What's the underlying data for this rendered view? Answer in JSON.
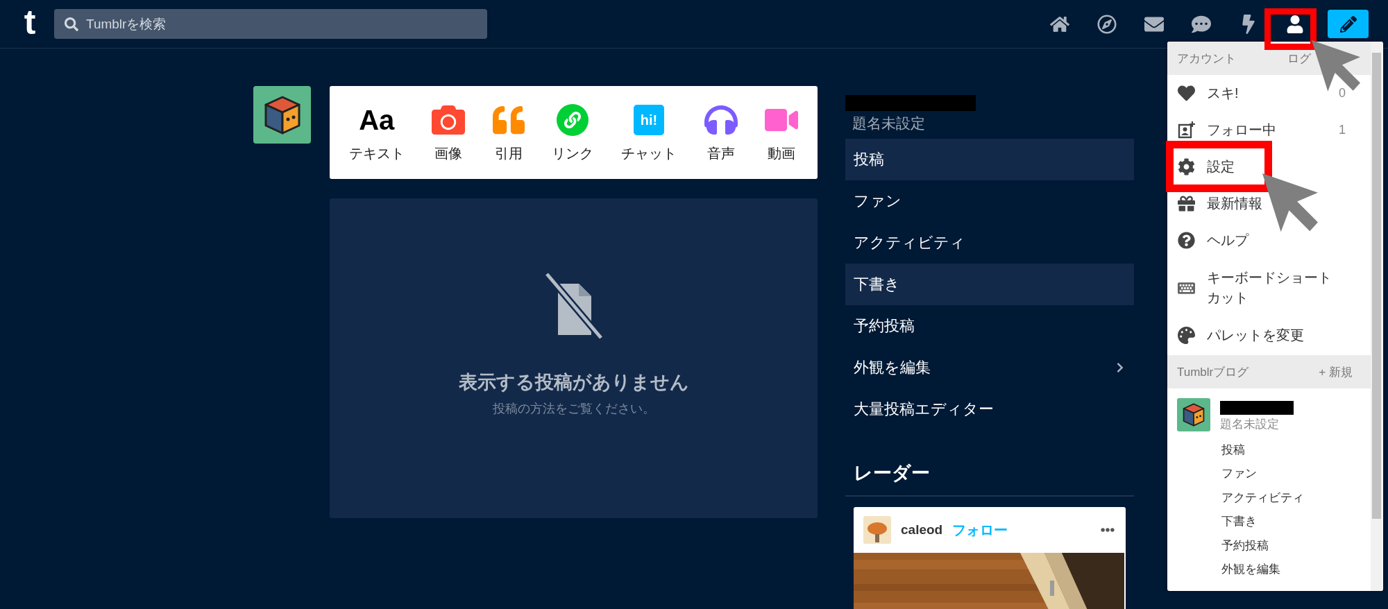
{
  "header": {
    "logo": "t",
    "search": {
      "placeholder": "Tumblrを検索"
    }
  },
  "post_types": [
    {
      "kind": "text",
      "glyph": "Aa",
      "label": "テキスト"
    },
    {
      "label": "画像"
    },
    {
      "kind": "quote",
      "label": "引用"
    },
    {
      "kind": "link",
      "label": "リンク"
    },
    {
      "kind": "chat",
      "glyph": "hi!",
      "label": "チャット"
    },
    {
      "kind": "audio",
      "label": "音声"
    },
    {
      "kind": "video",
      "label": "動画"
    }
  ],
  "empty_state": {
    "title": "表示する投稿がありません",
    "subtitle": "投稿の方法をご覧ください。"
  },
  "blog_menu": {
    "subtitle": "題名未設定",
    "items": [
      {
        "label": "投稿",
        "selected": true,
        "has_submenu": false
      },
      {
        "label": "ファン",
        "selected": false,
        "has_submenu": false
      },
      {
        "label": "アクティビティ",
        "selected": false,
        "has_submenu": false
      },
      {
        "label": "下書き",
        "selected": true,
        "has_submenu": false
      },
      {
        "label": "予約投稿",
        "selected": false,
        "has_submenu": false
      },
      {
        "label": "外観を編集",
        "selected": false,
        "has_submenu": true
      },
      {
        "label": "大量投稿エディター",
        "selected": false,
        "has_submenu": false
      }
    ]
  },
  "radar": {
    "title": "レーダー",
    "post": {
      "username": "caleod",
      "follow": "フォロー"
    }
  },
  "account_menu": {
    "header": {
      "title": "アカウント",
      "action": "ログ"
    },
    "items": [
      {
        "kind": "likes",
        "label": "スキ!",
        "count": "0"
      },
      {
        "kind": "following",
        "label": "フォロー中",
        "count": "1"
      },
      {
        "kind": "settings",
        "label": "設定"
      },
      {
        "kind": "news",
        "label": "最新情報"
      },
      {
        "kind": "help",
        "label": "ヘルプ"
      },
      {
        "kind": "keyboard",
        "label": "キーボードショートカット"
      },
      {
        "kind": "palette",
        "label": "パレットを変更"
      }
    ],
    "blogs_header": {
      "title": "Tumblrブログ",
      "action": "+ 新規"
    },
    "blog": {
      "subtitle": "題名未設定",
      "items": [
        "投稿",
        "ファン",
        "アクティビティ",
        "下書き",
        "予約投稿",
        "外観を編集"
      ]
    }
  }
}
